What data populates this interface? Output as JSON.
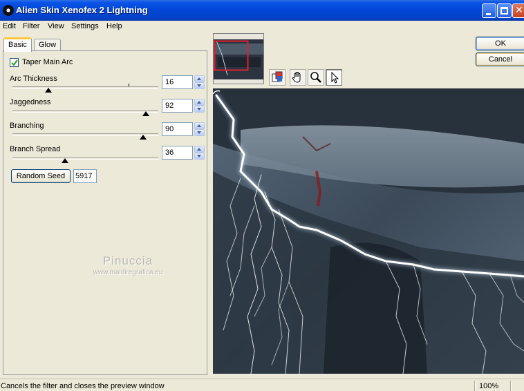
{
  "window": {
    "title": "Alien Skin Xenofex 2 Lightning"
  },
  "menu": [
    "Edit",
    "Filter",
    "View",
    "Settings",
    "Help"
  ],
  "tabs": [
    "Basic",
    "Glow"
  ],
  "taper": {
    "label": "Taper Main Arc",
    "checked": true
  },
  "sliders": [
    {
      "label": "Arc Thickness",
      "value": "16"
    },
    {
      "label": "Jaggedness",
      "value": "92"
    },
    {
      "label": "Branching",
      "value": "90"
    },
    {
      "label": "Branch Spread",
      "value": "36"
    }
  ],
  "random_seed": {
    "label": "Random Seed",
    "value": "5917"
  },
  "buttons": {
    "ok": "OK",
    "cancel": "Cancel"
  },
  "watermark": {
    "name": "Pinuccia",
    "url": "www.maidiregrafica.eu"
  },
  "status": {
    "text": "Cancels the filter and closes the preview window",
    "zoom": "100%"
  },
  "icons": [
    "app-icon",
    "minimize-icon",
    "maximize-icon",
    "close-icon",
    "checkmark-icon",
    "before-after-icon",
    "hand-icon",
    "magnifier-icon",
    "arrow-pointer-icon"
  ]
}
